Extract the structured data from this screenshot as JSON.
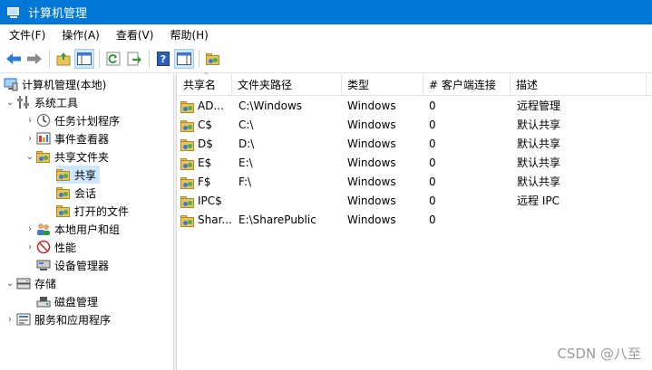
{
  "window": {
    "title": "计算机管理"
  },
  "menu": [
    "文件(F)",
    "操作(A)",
    "查看(V)",
    "帮助(H)"
  ],
  "toolbar": {
    "buttons": [
      "back-arrow-icon",
      "forward-arrow-icon",
      "up-folder-icon",
      "show-hide-tree-icon",
      "refresh-icon",
      "export-list-icon",
      "help-icon",
      "action-pane-icon",
      "share-folder-icon"
    ]
  },
  "tree": [
    {
      "label": "计算机管理(本地)",
      "level": 0,
      "expander": "",
      "icon": "computer-management-icon"
    },
    {
      "label": "系统工具",
      "level": 1,
      "expander": "open",
      "icon": "system-tools-icon"
    },
    {
      "label": "任务计划程序",
      "level": 2,
      "expander": "closed",
      "icon": "task-scheduler-icon"
    },
    {
      "label": "事件查看器",
      "level": 2,
      "expander": "closed",
      "icon": "event-viewer-icon"
    },
    {
      "label": "共享文件夹",
      "level": 2,
      "expander": "open",
      "icon": "shared-folder-icon"
    },
    {
      "label": "共享",
      "level": 3,
      "expander": "",
      "icon": "shares-icon",
      "selected": true
    },
    {
      "label": "会话",
      "level": 3,
      "expander": "",
      "icon": "sessions-icon"
    },
    {
      "label": "打开的文件",
      "level": 3,
      "expander": "",
      "icon": "open-files-icon"
    },
    {
      "label": "本地用户和组",
      "level": 2,
      "expander": "closed",
      "icon": "local-users-icon"
    },
    {
      "label": "性能",
      "level": 2,
      "expander": "closed",
      "icon": "performance-icon"
    },
    {
      "label": "设备管理器",
      "level": 2,
      "expander": "",
      "icon": "device-manager-icon"
    },
    {
      "label": "存储",
      "level": 1,
      "expander": "open",
      "icon": "storage-icon"
    },
    {
      "label": "磁盘管理",
      "level": 2,
      "expander": "",
      "icon": "disk-management-icon"
    },
    {
      "label": "服务和应用程序",
      "level": 1,
      "expander": "closed",
      "icon": "services-apps-icon"
    }
  ],
  "table": {
    "columns": [
      "共享名",
      "文件夹路径",
      "类型",
      "# 客户端连接",
      "描述"
    ],
    "rows": [
      [
        "AD...",
        "C:\\Windows",
        "Windows",
        "0",
        "远程管理"
      ],
      [
        "C$",
        "C:\\",
        "Windows",
        "0",
        "默认共享"
      ],
      [
        "D$",
        "D:\\",
        "Windows",
        "0",
        "默认共享"
      ],
      [
        "E$",
        "E:\\",
        "Windows",
        "0",
        "默认共享"
      ],
      [
        "F$",
        "F:\\",
        "Windows",
        "0",
        "默认共享"
      ],
      [
        "IPC$",
        "",
        "Windows",
        "0",
        "远程 IPC"
      ],
      [
        "Shar...",
        "E:\\SharePublic",
        "Windows",
        "0",
        ""
      ]
    ]
  },
  "watermark": "CSDN @八至",
  "colors": {
    "titlebar": "#0078d7",
    "selection": "#cce8ff",
    "folder": "#e8c25a"
  }
}
